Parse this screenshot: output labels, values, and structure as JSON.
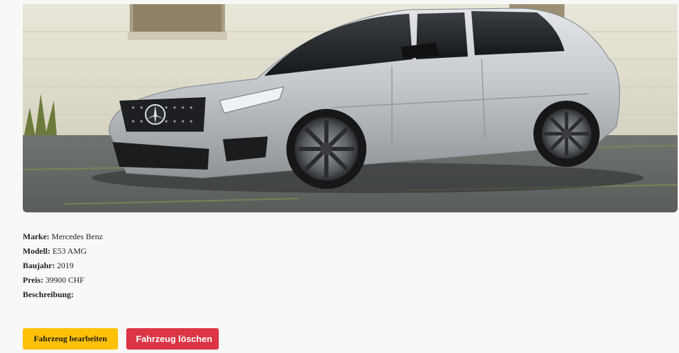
{
  "vehicle": {
    "fields": [
      {
        "label": "Marke:",
        "value": " Mercedes Benz"
      },
      {
        "label": "Modell:",
        "value": " E53 AMG"
      },
      {
        "label": "Baujahr:",
        "value": " 2019"
      },
      {
        "label": "Preis:",
        "value": " 39900 CHF"
      },
      {
        "label": "Beschreibung:",
        "value": ""
      }
    ]
  },
  "actions": {
    "edit_label": "Fahrzeug bearbeiten",
    "delete_label": "Fahrzeug löschen"
  },
  "colors": {
    "edit_button": "#ffc107",
    "delete_button": "#dc3545",
    "background": "#f8f8f8"
  }
}
